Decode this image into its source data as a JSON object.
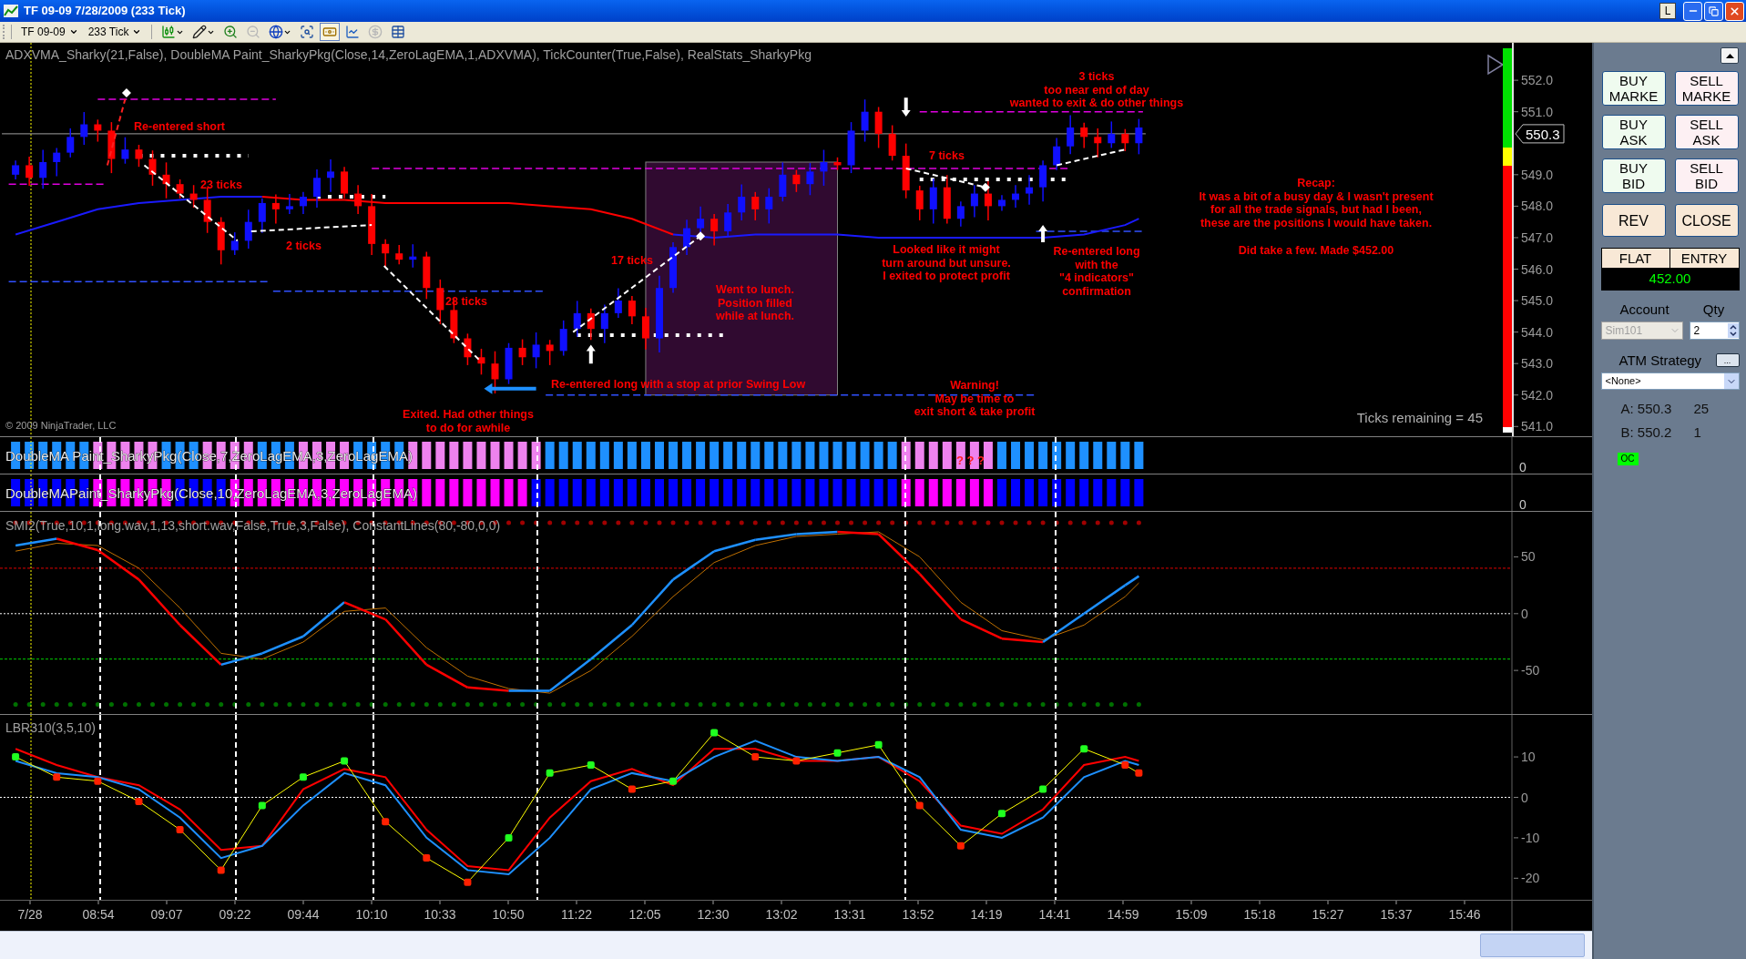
{
  "title_bar": {
    "title": "TF 09-09  7/28/2009 (233 Tick)",
    "pin_button": "L"
  },
  "toolbar": {
    "instrument": "TF 09-09",
    "period": "233 Tick",
    "tools": [
      {
        "kind": "chart-style",
        "selected": false,
        "disabled": false
      },
      {
        "kind": "drawing",
        "selected": false,
        "disabled": false
      },
      {
        "kind": "zoom-in",
        "selected": false,
        "disabled": false
      },
      {
        "kind": "zoom-out",
        "selected": false,
        "disabled": true
      },
      {
        "kind": "globe",
        "selected": false,
        "disabled": false
      },
      {
        "kind": "properties",
        "selected": false,
        "disabled": false
      },
      {
        "kind": "order-entry",
        "selected": true,
        "disabled": false
      },
      {
        "kind": "chart",
        "selected": false,
        "disabled": false
      },
      {
        "kind": "coin",
        "selected": false,
        "disabled": true
      },
      {
        "kind": "table",
        "selected": false,
        "disabled": false
      }
    ]
  },
  "price_panel": {
    "header": "ADXVMA_Sharky(21,False),  DoubleMA  Paint_SharkyPkg(Close,14,ZeroLagEMA,1,ADXVMA),  TickCounter(True,False),  RealStats_SharkyPkg",
    "copyright": "© 2009 NinjaTrader, LLC",
    "ticks_remaining": "Ticks remaining = 45",
    "last_price": "550.3",
    "axis_labels": [
      "552.0",
      "551.0",
      "549.0",
      "548.0",
      "547.0",
      "546.0",
      "545.0",
      "544.0",
      "543.0",
      "542.0",
      "541.0"
    ],
    "annotations": [
      {
        "lines": [
          "Re-entered short"
        ]
      },
      {
        "lines": [
          "23 ticks"
        ]
      },
      {
        "lines": [
          "2 ticks"
        ]
      },
      {
        "lines": [
          "28 ticks"
        ]
      },
      {
        "lines": [
          "17 ticks"
        ]
      },
      {
        "lines": [
          "Went to lunch.",
          "Position filled",
          "while at lunch."
        ]
      },
      {
        "lines": [
          "Re-entered long with a stop at prior Swing Low"
        ]
      },
      {
        "lines": [
          "Exited. Had other things",
          "to do for awhile"
        ]
      },
      {
        "lines": [
          "7 ticks"
        ]
      },
      {
        "lines": [
          "Looked like it might",
          "turn around but unsure.",
          "I exited to protect profit"
        ]
      },
      {
        "lines": [
          "Warning!",
          "May be time to",
          "exit short & take profit"
        ]
      },
      {
        "lines": [
          "3 ticks",
          "too near end of day",
          "wanted to exit & do other things"
        ]
      },
      {
        "lines": [
          "Re-entered long",
          "with the",
          "\"4 indicators\"",
          "confirmation"
        ]
      },
      {
        "lines": [
          "Recap:",
          "It was a bit of a busy day & I wasn't present",
          "for all the trade signals, but had I been,",
          "these are the positions I would have taken."
        ]
      },
      {
        "lines": [
          "Did take a few.  Made $452.00"
        ]
      }
    ]
  },
  "paint_rows": [
    {
      "label": "DoubleMA  Paint_SharkyPkg(Close,7,ZeroLagEMA,3,ZeroLagEMA)",
      "axis_label": "0",
      "marks": "? ? ?",
      "bars": [
        {
          "color": "#1e90ff"
        },
        {
          "color": "#1e90ff"
        },
        {
          "color": "#1e90ff"
        },
        {
          "color": "#1e90ff"
        },
        {
          "color": "#1e90ff"
        },
        {
          "color": "#1e90ff"
        },
        {
          "color": "#ee82ee"
        },
        {
          "color": "#ee82ee"
        },
        {
          "color": "#ee82ee"
        },
        {
          "color": "#ee82ee"
        },
        {
          "color": "#ee82ee"
        },
        {
          "color": "#1e90ff"
        },
        {
          "color": "#1e90ff"
        },
        {
          "color": "#1e90ff"
        },
        {
          "color": "#ee82ee"
        },
        {
          "color": "#ee82ee"
        },
        {
          "color": "#ee82ee"
        },
        {
          "color": "#ee82ee"
        },
        {
          "color": "#1e90ff"
        },
        {
          "color": "#1e90ff"
        },
        {
          "color": "#1e90ff"
        },
        {
          "color": "#ee82ee"
        },
        {
          "color": "#ee82ee"
        },
        {
          "color": "#ee82ee"
        },
        {
          "color": "#ee82ee"
        },
        {
          "color": "#1e90ff"
        },
        {
          "color": "#1e90ff"
        },
        {
          "color": "#1e90ff"
        },
        {
          "color": "#1e90ff"
        },
        {
          "color": "#ee82ee"
        },
        {
          "color": "#ee82ee"
        },
        {
          "color": "#ee82ee"
        },
        {
          "color": "#ee82ee"
        },
        {
          "color": "#ee82ee"
        },
        {
          "color": "#ee82ee"
        },
        {
          "color": "#ee82ee"
        },
        {
          "color": "#ee82ee"
        },
        {
          "color": "#ee82ee"
        },
        {
          "color": "#ee82ee"
        },
        {
          "color": "#1e90ff"
        },
        {
          "color": "#1e90ff"
        },
        {
          "color": "#1e90ff"
        },
        {
          "color": "#1e90ff"
        },
        {
          "color": "#1e90ff"
        },
        {
          "color": "#1e90ff"
        },
        {
          "color": "#1e90ff"
        },
        {
          "color": "#1e90ff"
        },
        {
          "color": "#1e90ff"
        },
        {
          "color": "#1e90ff"
        },
        {
          "color": "#1e90ff"
        },
        {
          "color": "#1e90ff"
        },
        {
          "color": "#1e90ff"
        },
        {
          "color": "#1e90ff"
        },
        {
          "color": "#1e90ff"
        },
        {
          "color": "#1e90ff"
        },
        {
          "color": "#1e90ff"
        },
        {
          "color": "#1e90ff"
        },
        {
          "color": "#1e90ff"
        },
        {
          "color": "#1e90ff"
        },
        {
          "color": "#1e90ff"
        },
        {
          "color": "#1e90ff"
        },
        {
          "color": "#1e90ff"
        },
        {
          "color": "#1e90ff"
        },
        {
          "color": "#1e90ff"
        },
        {
          "color": "#1e90ff"
        },
        {
          "color": "#ee82ee"
        },
        {
          "color": "#ee82ee"
        },
        {
          "color": "#ee82ee"
        },
        {
          "color": "#ee82ee"
        },
        {
          "color": "#ee82ee"
        },
        {
          "color": "#ee82ee"
        },
        {
          "color": "#ee82ee"
        },
        {
          "color": "#1e90ff"
        },
        {
          "color": "#1e90ff"
        },
        {
          "color": "#1e90ff"
        },
        {
          "color": "#1e90ff"
        },
        {
          "color": "#1e90ff"
        },
        {
          "color": "#1e90ff"
        },
        {
          "color": "#1e90ff"
        },
        {
          "color": "#1e90ff"
        },
        {
          "color": "#1e90ff"
        },
        {
          "color": "#1e90ff"
        },
        {
          "color": "#1e90ff"
        }
      ]
    },
    {
      "label": "DoubleMAPaint_SharkyPkg(Close,10,ZeroLagEMA,3,ZeroLagEMA)",
      "axis_label": "0",
      "bars": [
        {
          "color": "#0000ff"
        },
        {
          "color": "#0000ff"
        },
        {
          "color": "#0000ff"
        },
        {
          "color": "#0000ff"
        },
        {
          "color": "#0000ff"
        },
        {
          "color": "#0000ff"
        },
        {
          "color": "#ff00ff"
        },
        {
          "color": "#ff00ff"
        },
        {
          "color": "#ff00ff"
        },
        {
          "color": "#ff00ff"
        },
        {
          "color": "#ff00ff"
        },
        {
          "color": "#ff00ff"
        },
        {
          "color": "#0000ff"
        },
        {
          "color": "#0000ff"
        },
        {
          "color": "#0000ff"
        },
        {
          "color": "#0000ff"
        },
        {
          "color": "#ff00ff"
        },
        {
          "color": "#ff00ff"
        },
        {
          "color": "#ff00ff"
        },
        {
          "color": "#ff00ff"
        },
        {
          "color": "#ff00ff"
        },
        {
          "color": "#ff00ff"
        },
        {
          "color": "#ff00ff"
        },
        {
          "color": "#ff00ff"
        },
        {
          "color": "#ff00ff"
        },
        {
          "color": "#ff00ff"
        },
        {
          "color": "#ff00ff"
        },
        {
          "color": "#ff00ff"
        },
        {
          "color": "#ff00ff"
        },
        {
          "color": "#ff00ff"
        },
        {
          "color": "#ff00ff"
        },
        {
          "color": "#ff00ff"
        },
        {
          "color": "#ff00ff"
        },
        {
          "color": "#ff00ff"
        },
        {
          "color": "#ff00ff"
        },
        {
          "color": "#ff00ff"
        },
        {
          "color": "#ff00ff"
        },
        {
          "color": "#ff00ff"
        },
        {
          "color": "#0000ff"
        },
        {
          "color": "#0000ff"
        },
        {
          "color": "#0000ff"
        },
        {
          "color": "#0000ff"
        },
        {
          "color": "#0000ff"
        },
        {
          "color": "#0000ff"
        },
        {
          "color": "#0000ff"
        },
        {
          "color": "#0000ff"
        },
        {
          "color": "#0000ff"
        },
        {
          "color": "#0000ff"
        },
        {
          "color": "#0000ff"
        },
        {
          "color": "#0000ff"
        },
        {
          "color": "#0000ff"
        },
        {
          "color": "#0000ff"
        },
        {
          "color": "#0000ff"
        },
        {
          "color": "#0000ff"
        },
        {
          "color": "#0000ff"
        },
        {
          "color": "#0000ff"
        },
        {
          "color": "#0000ff"
        },
        {
          "color": "#0000ff"
        },
        {
          "color": "#0000ff"
        },
        {
          "color": "#0000ff"
        },
        {
          "color": "#0000ff"
        },
        {
          "color": "#0000ff"
        },
        {
          "color": "#0000ff"
        },
        {
          "color": "#0000ff"
        },
        {
          "color": "#0000ff"
        },
        {
          "color": "#ff00ff"
        },
        {
          "color": "#ff00ff"
        },
        {
          "color": "#ff00ff"
        },
        {
          "color": "#ff00ff"
        },
        {
          "color": "#ff00ff"
        },
        {
          "color": "#ff00ff"
        },
        {
          "color": "#ff00ff"
        },
        {
          "color": "#0000ff"
        },
        {
          "color": "#0000ff"
        },
        {
          "color": "#0000ff"
        },
        {
          "color": "#0000ff"
        },
        {
          "color": "#0000ff"
        },
        {
          "color": "#0000ff"
        },
        {
          "color": "#0000ff"
        },
        {
          "color": "#0000ff"
        },
        {
          "color": "#0000ff"
        },
        {
          "color": "#0000ff"
        },
        {
          "color": "#0000ff"
        }
      ]
    }
  ],
  "smi_panel": {
    "header": "SMI2(True,10,1,long.wav,1,13,short.wav,False,True,3,False),  ConstantLines(80,-80,0,0)",
    "axis_labels": [
      "50",
      "0",
      "-50"
    ]
  },
  "lbr_panel": {
    "header": "LBR310(3,5,10)",
    "axis_labels": [
      "10",
      "0",
      "-10",
      "-20"
    ]
  },
  "time_axis": [
    "7/28",
    "08:54",
    "09:07",
    "09:22",
    "09:44",
    "10:10",
    "10:33",
    "10:50",
    "11:22",
    "12:05",
    "12:30",
    "13:02",
    "13:31",
    "13:52",
    "14:19",
    "14:41",
    "14:59",
    "15:09",
    "15:18",
    "15:27",
    "15:37",
    "15:46"
  ],
  "order_panel": {
    "buttons": [
      {
        "label": "BUY\nMARKE",
        "kind": "buy"
      },
      {
        "label": "SELL\nMARKE",
        "kind": "sell"
      },
      {
        "label": "BUY\nASK",
        "kind": "buy"
      },
      {
        "label": "SELL\nASK",
        "kind": "sell"
      },
      {
        "label": "BUY\nBID",
        "kind": "buy"
      },
      {
        "label": "SELL\nBID",
        "kind": "sell"
      },
      {
        "label": "REV",
        "kind": "action"
      },
      {
        "label": "CLOSE",
        "kind": "action"
      }
    ],
    "position": {
      "status": "FLAT",
      "entry": "ENTRY",
      "pnl": "452.00"
    },
    "account": {
      "label": "Account",
      "value": "Sim101",
      "disabled": true
    },
    "quantity": {
      "label": "Qty",
      "value": "2"
    },
    "atm": {
      "label": "ATM Strategy",
      "button": "...",
      "value": "<None>"
    },
    "quotes": [
      {
        "label": "A: 550.3",
        "size": "25"
      },
      {
        "label": "B: 550.2",
        "size": "1"
      }
    ],
    "status_badge": "OC"
  }
}
